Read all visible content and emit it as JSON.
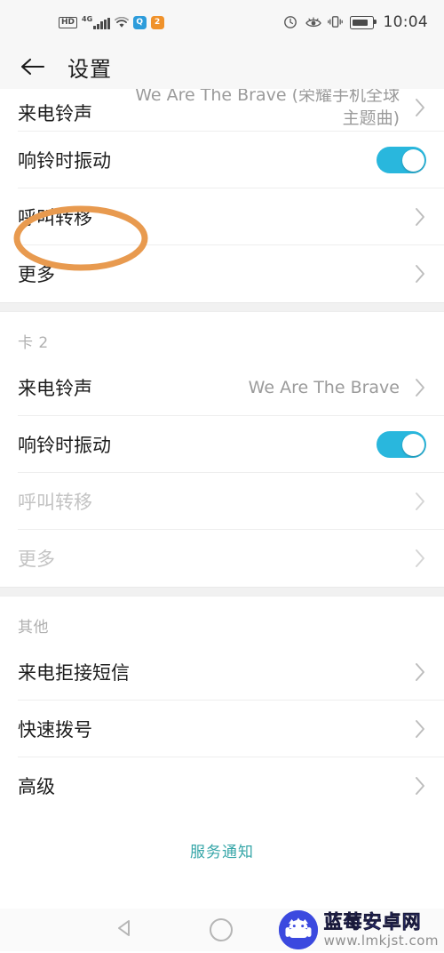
{
  "statusbar": {
    "left_icons": [
      {
        "name": "hd-icon",
        "label": "HD"
      },
      {
        "name": "signal-4g-icon",
        "label": "4G"
      },
      {
        "name": "wifi-icon",
        "label": "wifi"
      },
      {
        "name": "app-badge-blue-icon",
        "label": "Q"
      },
      {
        "name": "app-badge-orange-icon",
        "label": "2"
      }
    ],
    "right_icons": [
      {
        "name": "alarm-icon",
        "label": "alarm"
      },
      {
        "name": "eye-comfort-icon",
        "label": "eye"
      },
      {
        "name": "vibrate-icon",
        "label": "vibrate"
      },
      {
        "name": "battery-icon",
        "label": "battery"
      }
    ],
    "time": "10:04"
  },
  "appbar": {
    "back_icon": "back-arrow-icon",
    "title": "设置"
  },
  "sections": [
    {
      "id": "card1",
      "header": null,
      "rows": [
        {
          "label": "来电铃声",
          "value": "We Are The Brave (荣耀手机全球主题曲)",
          "type": "chevron",
          "disabled": false,
          "clipped": true
        },
        {
          "label": "响铃时振动",
          "value": "",
          "type": "toggle",
          "toggle_on": true,
          "disabled": false
        },
        {
          "label": "呼叫转移",
          "value": "",
          "type": "chevron",
          "disabled": false,
          "annotated": true
        },
        {
          "label": "更多",
          "value": "",
          "type": "chevron",
          "disabled": false
        }
      ]
    },
    {
      "id": "card2",
      "header": "卡 2",
      "rows": [
        {
          "label": "来电铃声",
          "value": "We Are The Brave",
          "type": "chevron",
          "disabled": false
        },
        {
          "label": "响铃时振动",
          "value": "",
          "type": "toggle",
          "toggle_on": true,
          "disabled": false
        },
        {
          "label": "呼叫转移",
          "value": "",
          "type": "chevron",
          "disabled": true
        },
        {
          "label": "更多",
          "value": "",
          "type": "chevron",
          "disabled": true
        }
      ]
    },
    {
      "id": "other",
      "header": "其他",
      "rows": [
        {
          "label": "来电拒接短信",
          "value": "",
          "type": "chevron",
          "disabled": false
        },
        {
          "label": "快速拨号",
          "value": "",
          "type": "chevron",
          "disabled": false
        },
        {
          "label": "高级",
          "value": "",
          "type": "chevron",
          "disabled": false
        }
      ]
    }
  ],
  "footer": {
    "service_link": "服务通知"
  },
  "annotation": {
    "shape": "ellipse",
    "color": "#e89a4f",
    "target_label": "呼叫转移"
  },
  "navbar": {
    "back_icon": "nav-back-triangle-icon",
    "home_icon": "nav-home-circle-icon"
  },
  "watermark": {
    "site_name": "蓝莓安卓网",
    "url": "www.lmkjst.com",
    "logo_icon": "blueberry-android-logo-icon"
  },
  "colors": {
    "toggle_on": "#29b7dd",
    "annotation": "#e89a4f",
    "link": "#36a6a8",
    "watermark": "#3b49df"
  }
}
